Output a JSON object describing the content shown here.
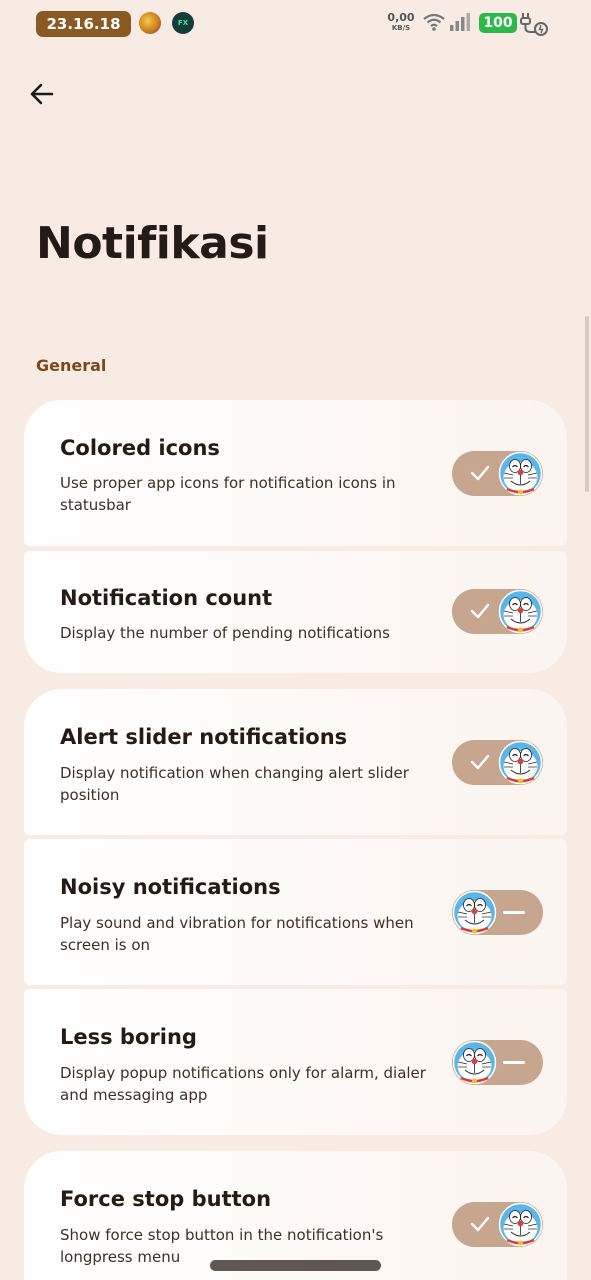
{
  "status_bar": {
    "time": "23.16.18",
    "net_speed_value": "0,00",
    "net_speed_unit": "KB/S",
    "battery": "100",
    "app_badge": "FX"
  },
  "header": {
    "back_icon": "arrow-left-icon",
    "title": "Notifikasi"
  },
  "section": {
    "label": "General"
  },
  "settings": [
    {
      "title": "Colored icons",
      "summary": "Use proper app icons for notification icons in statusbar",
      "enabled": true
    },
    {
      "title": "Notification count",
      "summary": "Display the number of pending notifications",
      "enabled": true
    },
    {
      "title": "Alert slider notifications",
      "summary": "Display notification when changing alert slider position",
      "enabled": true
    },
    {
      "title": "Noisy notifications",
      "summary": "Play sound and vibration for notifications when screen is on",
      "enabled": false
    },
    {
      "title": "Less boring",
      "summary": "Display popup notifications only for alarm, dialer and messaging app",
      "enabled": false
    },
    {
      "title": "Force stop button",
      "summary": "Show force stop button in the notification's longpress menu",
      "enabled": true
    }
  ],
  "colors": {
    "background": "#f8ebe4",
    "toggle_track": "#c6a68e",
    "accent_text": "#7a4a1c",
    "clock_bg": "#8a5a24",
    "battery_bg": "#2fb84a"
  }
}
